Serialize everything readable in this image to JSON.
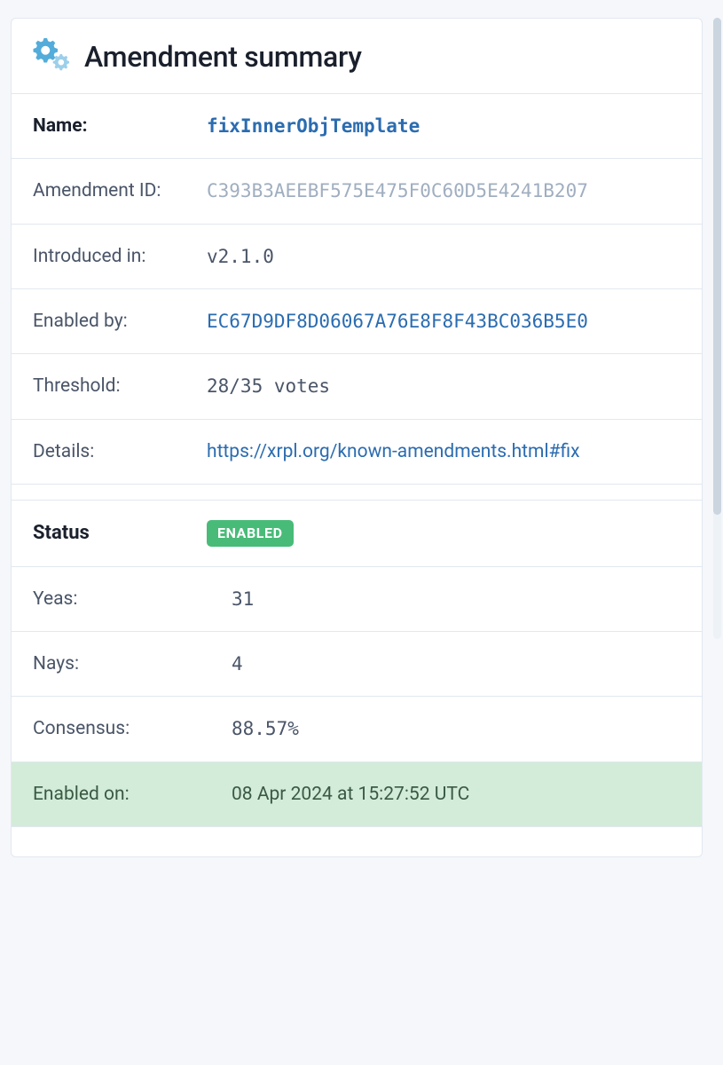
{
  "header": {
    "title": "Amendment summary"
  },
  "summary": {
    "name_label": "Name:",
    "name_value": "fixInnerObjTemplate",
    "amendment_id_label": "Amendment ID:",
    "amendment_id_value": "C393B3AEEBF575E475F0C60D5E4241B207",
    "introduced_label": "Introduced in:",
    "introduced_value": "v2.1.0",
    "enabled_by_label": "Enabled by:",
    "enabled_by_value": "EC67D9DF8D06067A76E8F8F43BC036B5E0",
    "threshold_label": "Threshold:",
    "threshold_value": "28/35 votes",
    "details_label": "Details:",
    "details_value": "https://xrpl.org/known-amendments.html#fix"
  },
  "status": {
    "status_label": "Status",
    "status_badge": "ENABLED",
    "yeas_label": "Yeas:",
    "yeas_value": "31",
    "nays_label": "Nays:",
    "nays_value": "4",
    "consensus_label": "Consensus:",
    "consensus_value": "88.57%",
    "enabled_on_label": "Enabled on:",
    "enabled_on_value": "08 Apr 2024 at 15:27:52 UTC"
  }
}
